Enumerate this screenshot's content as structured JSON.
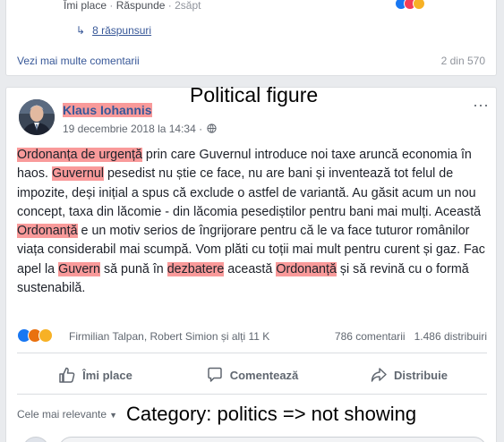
{
  "previous_post": {
    "like_label": "Îmi place",
    "reply_label": "Răspunde",
    "time_label": "2săpt",
    "replies_label": "8 răspunsuri",
    "more_comments_label": "Vezi mai multe comentarii",
    "page_count": "2 din 570",
    "reactions": [
      "like",
      "love",
      "haha"
    ]
  },
  "post": {
    "author": "Klaus Iohannis",
    "date": "19 decembrie 2018 la 14:34",
    "separator": " · ",
    "overlay_label": "Political figure",
    "more_icon": "more-horizontal-icon",
    "text_segments": [
      {
        "text": "Ordonanța de urgență",
        "hl": true
      },
      {
        "text": " prin care Guvernul introduce noi taxe aruncă economia în haos. ",
        "hl": false
      },
      {
        "text": "Guvernul",
        "hl": true
      },
      {
        "text": " pesedist nu știe ce face, nu are bani și inventează tot felul de impozite, deși inițial a spus că exclude o astfel de variantă. Au găsit acum un nou concept, taxa din lăcomie - din lăcomia pesediștilor pentru bani mai mulți. Această ",
        "hl": false
      },
      {
        "text": "Ordonanță",
        "hl": true
      },
      {
        "text": " e un motiv serios de îngrijorare pentru că le va face tuturor românilor viața considerabil mai scumpă. Vom plăti cu toții mai mult pentru curent și gaz. Fac apel la ",
        "hl": false
      },
      {
        "text": "Guvern",
        "hl": true
      },
      {
        "text": " să pună în ",
        "hl": false
      },
      {
        "text": "dezbatere",
        "hl": true
      },
      {
        "text": " această ",
        "hl": false
      },
      {
        "text": "Ordonanță",
        "hl": true
      },
      {
        "text": " și să revină cu o formă sustenabilă.",
        "hl": false
      }
    ],
    "highlight_color": "#f99a9a",
    "reactions": [
      "like",
      "angry",
      "sad"
    ],
    "reactors": "Firmilian Talpan, Robert Simion și alți 11 K",
    "comments_count": "786 comentarii",
    "shares_count": "1.486 distribuiri",
    "actions": {
      "like": "Îmi place",
      "comment": "Comentează",
      "share": "Distribuie"
    },
    "sort_label": "Cele mai relevante",
    "category_label": "Category: politics => not showing"
  },
  "colors": {
    "link": "#385898",
    "author": "#365899",
    "like_blue": "#1877f2",
    "angry": "#e9710f",
    "sad": "#f7b125"
  }
}
